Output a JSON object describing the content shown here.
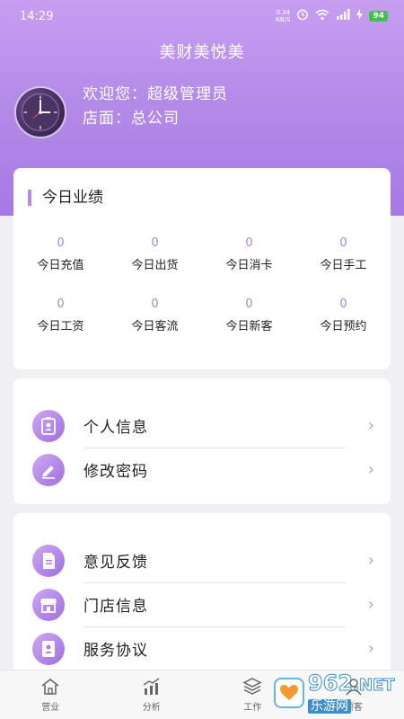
{
  "status_bar": {
    "time": "14:29",
    "net_speed_value": "0.34",
    "net_speed_unit": "KB/S",
    "battery": "94"
  },
  "app_title": "美财美悦美",
  "user": {
    "welcome": "欢迎您：超级管理员",
    "store": "店面：总公司"
  },
  "performance": {
    "title": "今日业绩",
    "stats": [
      {
        "value": "0",
        "label": "今日充值"
      },
      {
        "value": "0",
        "label": "今日出货"
      },
      {
        "value": "0",
        "label": "今日消卡"
      },
      {
        "value": "0",
        "label": "今日手工"
      },
      {
        "value": "0",
        "label": "今日工资"
      },
      {
        "value": "0",
        "label": "今日客流"
      },
      {
        "value": "0",
        "label": "今日新客"
      },
      {
        "value": "0",
        "label": "今日预约"
      }
    ]
  },
  "menu_group_1": [
    {
      "label": "个人信息",
      "icon": "id-card-icon"
    },
    {
      "label": "修改密码",
      "icon": "pencil-icon"
    }
  ],
  "menu_group_2": [
    {
      "label": "意见反馈",
      "icon": "document-icon"
    },
    {
      "label": "门店信息",
      "icon": "storefront-icon"
    },
    {
      "label": "服务协议",
      "icon": "contact-card-icon"
    }
  ],
  "menu_arrow": "›",
  "tabs": [
    {
      "label": "营业",
      "icon": "home-icon"
    },
    {
      "label": "分析",
      "icon": "chart-icon"
    },
    {
      "label": "工作",
      "icon": "layers-icon"
    },
    {
      "label": "顾客",
      "icon": "user-icon"
    }
  ],
  "watermark": {
    "main": "962",
    "suffix": ".NET",
    "sub": "乐游网"
  },
  "colors": {
    "accent": "#b48be8",
    "header_top": "#c89ef2",
    "header_bottom": "#a679e4"
  }
}
